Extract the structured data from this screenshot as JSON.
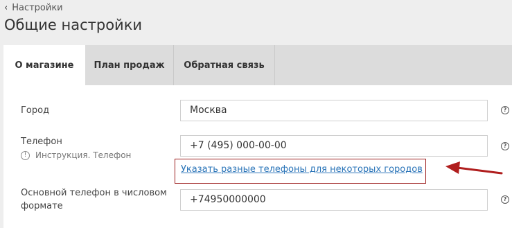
{
  "breadcrumb": {
    "label": "Настройки"
  },
  "page": {
    "title": "Общие настройки"
  },
  "tabs": [
    {
      "label": "О магазине",
      "active": true
    },
    {
      "label": "План продаж",
      "active": false
    },
    {
      "label": "Обратная связь",
      "active": false
    }
  ],
  "form": {
    "city": {
      "label": "Город",
      "value": "Москва"
    },
    "phone": {
      "label": "Телефон",
      "value": "+7 (495) 000-00-00",
      "hint": "Инструкция. Телефон",
      "link": "Указать разные телефоны для некоторых городов"
    },
    "numeric_phone": {
      "label_line1": "Основной телефон в числовом",
      "label_line2": "формате",
      "value": "+74950000000"
    },
    "help_glyph": "?"
  },
  "colors": {
    "highlight": "#9b1b1b",
    "link": "#2a74b8",
    "tab_bar": "#dcdcdc"
  }
}
